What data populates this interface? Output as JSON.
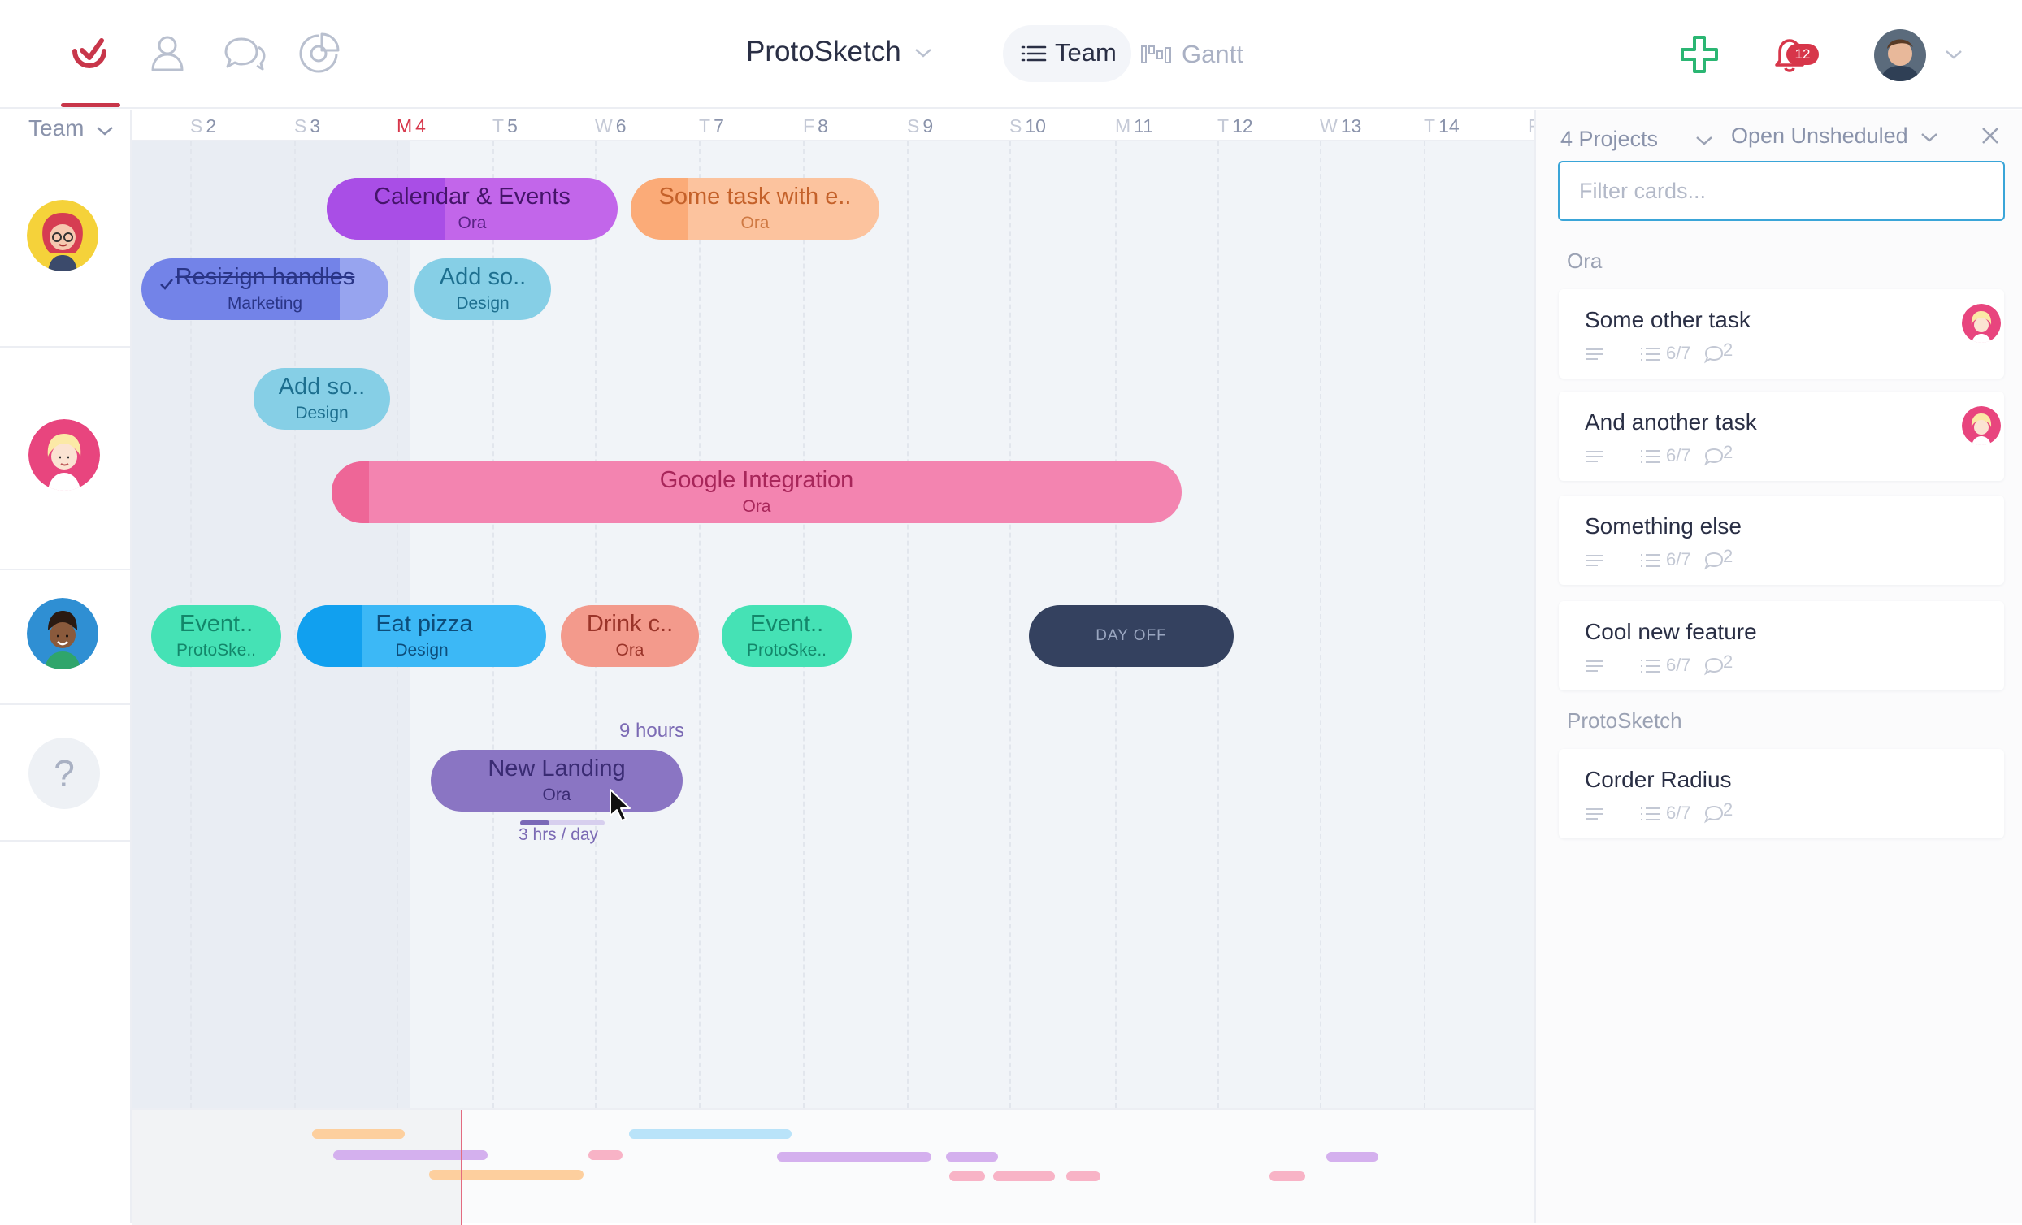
{
  "header": {
    "nav_icons": [
      "logo-icon",
      "person-icon",
      "chat-icon",
      "pie-chart-icon"
    ],
    "project_title": "ProtoSketch",
    "view_tabs": [
      {
        "label": "Team",
        "icon": "list-icon",
        "active": true
      },
      {
        "label": "Gantt",
        "icon": "gantt-icon",
        "active": false
      }
    ],
    "notifications_count": "12",
    "colors": {
      "brand": "#c8364a",
      "add": "#2bb673",
      "badge": "#d7364a"
    }
  },
  "team_selector": {
    "label": "Team"
  },
  "days": [
    {
      "letter": "S",
      "num": "2"
    },
    {
      "letter": "S",
      "num": "3"
    },
    {
      "letter": "M",
      "num": "4",
      "today": true
    },
    {
      "letter": "T",
      "num": "5"
    },
    {
      "letter": "W",
      "num": "6"
    },
    {
      "letter": "T",
      "num": "7"
    },
    {
      "letter": "F",
      "num": "8"
    },
    {
      "letter": "S",
      "num": "9"
    },
    {
      "letter": "S",
      "num": "10"
    },
    {
      "letter": "M",
      "num": "11"
    },
    {
      "letter": "T",
      "num": "12"
    },
    {
      "letter": "W",
      "num": "13"
    },
    {
      "letter": "T",
      "num": "14"
    },
    {
      "letter": "F",
      "num": ""
    }
  ],
  "tasks": {
    "calendar_events": {
      "title": "Calendar & Events",
      "project": "Ora"
    },
    "some_task": {
      "title": "Some task with e..",
      "project": "Ora"
    },
    "resizing_handles": {
      "title": "Resizign handles",
      "project": "Marketing",
      "done": true
    },
    "add_so_1": {
      "title": "Add so..",
      "project": "Design"
    },
    "add_so_2": {
      "title": "Add so..",
      "project": "Design"
    },
    "google_integration": {
      "title": "Google Integration",
      "project": "Ora"
    },
    "event_1": {
      "title": "Event..",
      "project": "ProtoSke.."
    },
    "eat_pizza": {
      "title": "Eat pizza",
      "project": "Design"
    },
    "drink_c": {
      "title": "Drink c..",
      "project": "Ora"
    },
    "event_2": {
      "title": "Event..",
      "project": "ProtoSke.."
    },
    "day_off": {
      "title": "DAY OFF"
    },
    "new_landing": {
      "title": "New Landing",
      "project": "Ora",
      "hours": "9 hours",
      "rate": "3 hrs / day",
      "rate_progress": 0.35
    }
  },
  "unassigned_label": "?",
  "panel": {
    "projects_label": "4 Projects",
    "filter_label": "Open Unsheduled",
    "search_placeholder": "Filter cards...",
    "groups": [
      {
        "name": "Ora",
        "cards": [
          {
            "title": "Some other task",
            "checklist": "6/7",
            "comments": "2",
            "has_avatar": true
          },
          {
            "title": "And another task",
            "checklist": "6/7",
            "comments": "2",
            "has_avatar": true
          },
          {
            "title": "Something else",
            "checklist": "6/7",
            "comments": "2",
            "has_avatar": false
          },
          {
            "title": "Cool new feature",
            "checklist": "6/7",
            "comments": "2",
            "has_avatar": false
          }
        ]
      },
      {
        "name": "ProtoSketch",
        "cards": [
          {
            "title": "Corder Radius",
            "checklist": "6/7",
            "comments": "2",
            "has_avatar": false
          }
        ]
      }
    ]
  }
}
